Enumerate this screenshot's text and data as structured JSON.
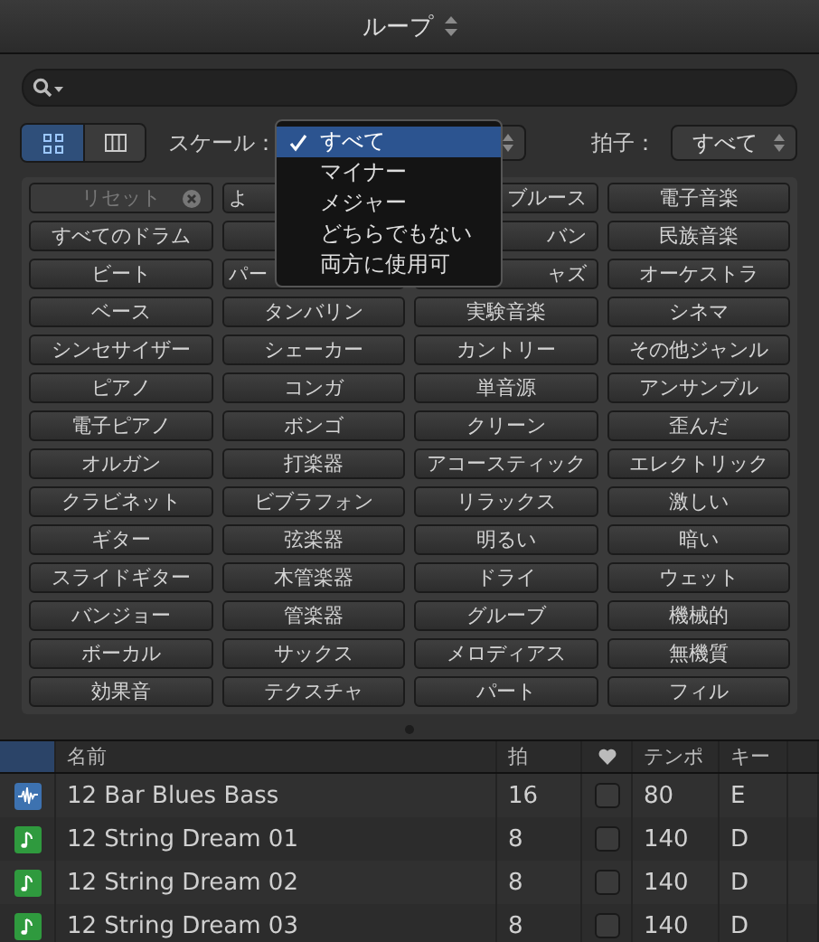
{
  "window": {
    "title": "ループ"
  },
  "view_buttons": [
    {
      "kind": "grid",
      "selected": true
    },
    {
      "kind": "columns",
      "selected": false
    }
  ],
  "scale": {
    "label": "スケール："
  },
  "scale_menu": [
    {
      "label": "すべて",
      "checked": true,
      "selected": true
    },
    {
      "label": "マイナー",
      "checked": false,
      "selected": false
    },
    {
      "label": "メジャー",
      "checked": false,
      "selected": false
    },
    {
      "label": "どちらでもない",
      "checked": false,
      "selected": false
    },
    {
      "label": "両方に使用可",
      "checked": false,
      "selected": false
    }
  ],
  "meter": {
    "label": "拍子：",
    "value": "すべて"
  },
  "keywords": [
    [
      {
        "label": "リセット",
        "kind": "reset",
        "disabled": true
      },
      {
        "label": "よ",
        "covered": true
      },
      {
        "label": "ブルース",
        "covered": true
      },
      {
        "label": "電子音楽"
      }
    ],
    [
      {
        "label": "すべてのドラム"
      },
      {
        "kind": "blank"
      },
      {
        "label": "バン",
        "covered": true
      },
      {
        "label": "民族音楽"
      }
    ],
    [
      {
        "label": "ビート"
      },
      {
        "label": "パー",
        "covered": true
      },
      {
        "label": "ャズ",
        "covered": true
      },
      {
        "label": "オーケストラ"
      }
    ],
    [
      {
        "label": "ベース"
      },
      {
        "label": "タンバリン"
      },
      {
        "label": "実験音楽"
      },
      {
        "label": "シネマ"
      }
    ],
    [
      {
        "label": "シンセサイザー"
      },
      {
        "label": "シェーカー"
      },
      {
        "label": "カントリー"
      },
      {
        "label": "その他ジャンル"
      }
    ],
    [
      {
        "label": "ピアノ"
      },
      {
        "label": "コンガ"
      },
      {
        "label": "単音源"
      },
      {
        "label": "アンサンブル"
      }
    ],
    [
      {
        "label": "電子ピアノ"
      },
      {
        "label": "ボンゴ"
      },
      {
        "label": "クリーン"
      },
      {
        "label": "歪んだ"
      }
    ],
    [
      {
        "label": "オルガン"
      },
      {
        "label": "打楽器"
      },
      {
        "label": "アコースティック"
      },
      {
        "label": "エレクトリック"
      }
    ],
    [
      {
        "label": "クラビネット"
      },
      {
        "label": "ビブラフォン"
      },
      {
        "label": "リラックス"
      },
      {
        "label": "激しい"
      }
    ],
    [
      {
        "label": "ギター"
      },
      {
        "label": "弦楽器"
      },
      {
        "label": "明るい"
      },
      {
        "label": "暗い"
      }
    ],
    [
      {
        "label": "スライドギター"
      },
      {
        "label": "木管楽器"
      },
      {
        "label": "ドライ"
      },
      {
        "label": "ウェット"
      }
    ],
    [
      {
        "label": "バンジョー"
      },
      {
        "label": "管楽器"
      },
      {
        "label": "グルーブ"
      },
      {
        "label": "機械的"
      }
    ],
    [
      {
        "label": "ボーカル"
      },
      {
        "label": "サックス"
      },
      {
        "label": "メロディアス"
      },
      {
        "label": "無機質"
      }
    ],
    [
      {
        "label": "効果音"
      },
      {
        "label": "テクスチャ"
      },
      {
        "label": "パート"
      },
      {
        "label": "フィル"
      }
    ]
  ],
  "table": {
    "columns": [
      "名前",
      "拍",
      "テンポ",
      "キー"
    ],
    "rows": [
      {
        "kind": "audio",
        "name": "12 Bar Blues Bass",
        "beats": "16",
        "favorite": false,
        "tempo": "80",
        "key": "E"
      },
      {
        "kind": "midi",
        "name": "12 String Dream 01",
        "beats": "8",
        "favorite": false,
        "tempo": "140",
        "key": "D"
      },
      {
        "kind": "midi",
        "name": "12 String Dream 02",
        "beats": "8",
        "favorite": false,
        "tempo": "140",
        "key": "D"
      },
      {
        "kind": "midi",
        "name": "12 String Dream 03",
        "beats": "8",
        "favorite": false,
        "tempo": "140",
        "key": "D"
      }
    ]
  }
}
